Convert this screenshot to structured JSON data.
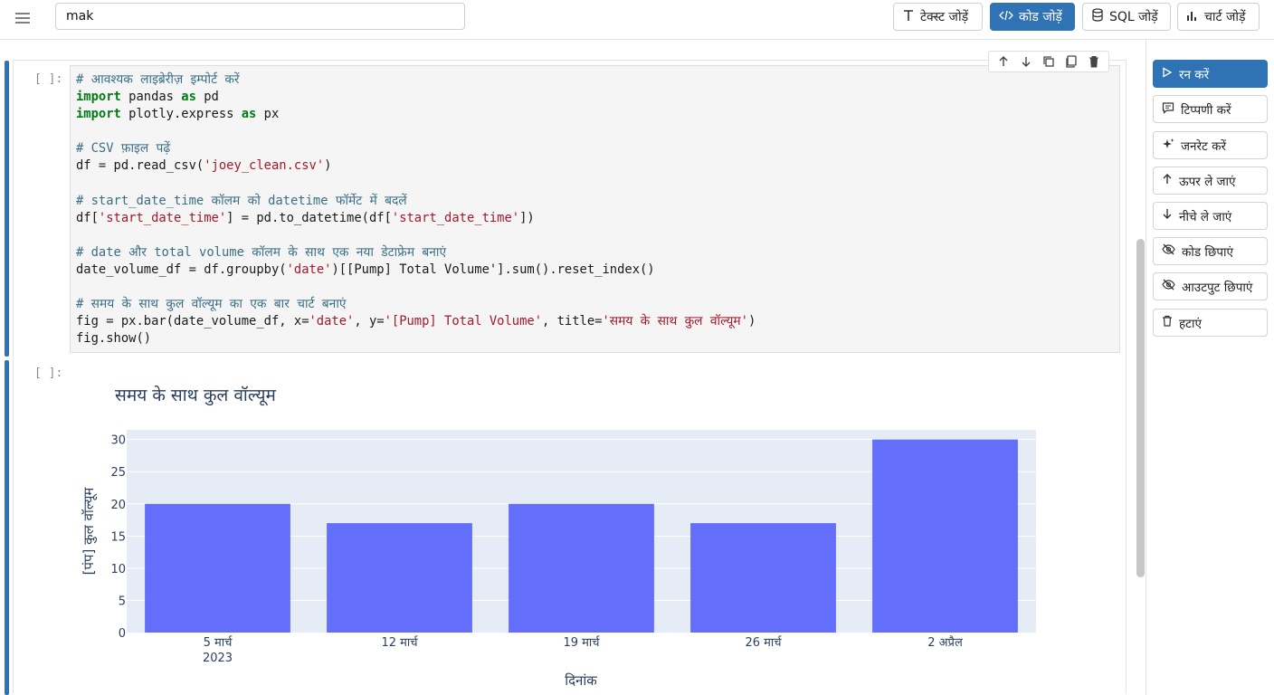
{
  "search": {
    "value": "mak"
  },
  "toolbar": {
    "add_text": "टेक्स्ट जोड़ें",
    "add_code": "कोड जोड़ें",
    "add_sql": "SQL जोड़ें",
    "add_chart": "चार्ट जोड़ें"
  },
  "cells": [
    {
      "prompt": "[ ]:",
      "code_lines": [
        [
          [
            "cm",
            "# आवश्यक लाइब्रेरीज़ इम्पोर्ट करें"
          ]
        ],
        [
          [
            "kw",
            "import"
          ],
          [
            "t",
            " pandas "
          ],
          [
            "kw",
            "as"
          ],
          [
            "t",
            " pd"
          ]
        ],
        [
          [
            "kw",
            "import"
          ],
          [
            "t",
            " plotly.express "
          ],
          [
            "kw",
            "as"
          ],
          [
            "t",
            " px"
          ]
        ],
        [
          [
            "t",
            ""
          ]
        ],
        [
          [
            "cm",
            "# CSV फ़ाइल पढ़ें"
          ]
        ],
        [
          [
            "t",
            "df = pd.read_csv("
          ],
          [
            "st",
            "'joey_clean.csv'"
          ],
          [
            "t",
            ")"
          ]
        ],
        [
          [
            "t",
            ""
          ]
        ],
        [
          [
            "cm",
            "# start_date_time कॉलम को datetime फॉर्मेट में बदलें"
          ]
        ],
        [
          [
            "t",
            "df["
          ],
          [
            "st",
            "'start_date_time'"
          ],
          [
            "t",
            "] = pd.to_datetime(df["
          ],
          [
            "st",
            "'start_date_time'"
          ],
          [
            "t",
            "])"
          ]
        ],
        [
          [
            "t",
            ""
          ]
        ],
        [
          [
            "cm",
            "# date और total volume कॉलम के साथ एक नया डेटाफ्रेम बनाएं"
          ]
        ],
        [
          [
            "t",
            "date_volume_df = df.groupby("
          ],
          [
            "st",
            "'date'"
          ],
          [
            "t",
            ")[[Pump] Total Volume'].sum().reset_index()"
          ]
        ],
        [
          [
            "t",
            ""
          ]
        ],
        [
          [
            "cm",
            "# समय के साथ कुल वॉल्यूम का एक बार चार्ट बनाएं"
          ]
        ],
        [
          [
            "t",
            "fig = px.bar(date_volume_df, x="
          ],
          [
            "st",
            "'date'"
          ],
          [
            "t",
            ", y="
          ],
          [
            "st",
            "'[Pump] Total Volume'"
          ],
          [
            "t",
            ", title="
          ],
          [
            "st",
            "'समय के साथ कुल वॉल्यूम'"
          ],
          [
            "t",
            ")"
          ]
        ],
        [
          [
            "t",
            "fig.show()"
          ]
        ]
      ]
    },
    {
      "prompt": "[ ]:"
    }
  ],
  "chart_data": {
    "type": "bar",
    "title": "समय के साथ कुल वॉल्यूम",
    "xlabel": "दिनांक",
    "ylabel": "[पंप] कुल वॉल्यूम",
    "categories": [
      "5 मार्च",
      "12 मार्च",
      "19 मार्च",
      "26 मार्च",
      "2 अप्रैल"
    ],
    "x_sublabel": "2023",
    "values": [
      20,
      17,
      20,
      17,
      30
    ],
    "ylim": [
      0,
      31.5
    ],
    "yticks": [
      0,
      5,
      10,
      15,
      20,
      25,
      30
    ],
    "bar_color": "#636efa",
    "plot_bg": "#e5ecf6",
    "grid": true
  },
  "sidebar": {
    "run": "रन करें",
    "comment": "टिप्पणी करें",
    "generate": "जनरेट करें",
    "move_up": "ऊपर ले जाएं",
    "move_down": "नीचे ले जाएं",
    "hide_code": "कोड छिपाएं",
    "hide_output": "आउटपुट छिपाएं",
    "delete": "हटाएं"
  },
  "colors": {
    "accent": "#2f73b5"
  }
}
